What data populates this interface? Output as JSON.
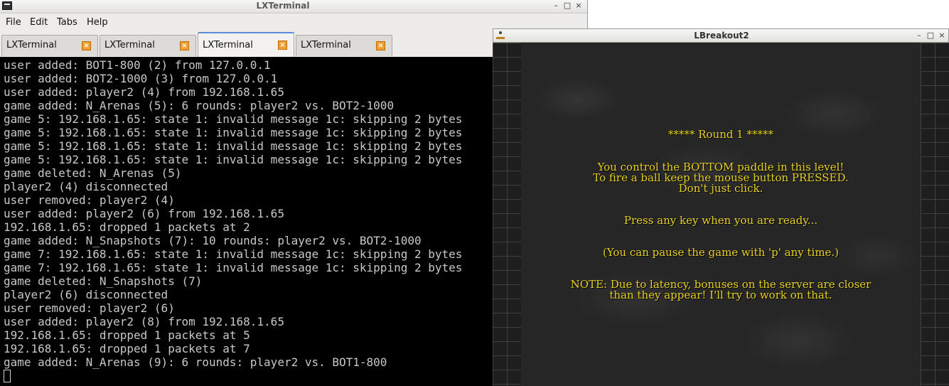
{
  "terminal": {
    "title": "LXTerminal",
    "controls": {
      "minimize": "–",
      "maximize": "□",
      "close": "×"
    },
    "menu": [
      "File",
      "Edit",
      "Tabs",
      "Help"
    ],
    "tabs": [
      {
        "label": "LXTerminal",
        "close": "×"
      },
      {
        "label": "LXTerminal",
        "close": "×"
      },
      {
        "label": "LXTerminal",
        "close": "×"
      },
      {
        "label": "LXTerminal",
        "close": "×"
      }
    ],
    "lines": [
      "user added: BOT1-800 (2) from 127.0.0.1",
      "user added: BOT2-1000 (3) from 127.0.0.1",
      "user added: player2 (4) from 192.168.1.65",
      "game added: N_Arenas (5): 6 rounds: player2 vs. BOT2-1000",
      "game 5: 192.168.1.65: state 1: invalid message 1c: skipping 2 bytes",
      "game 5: 192.168.1.65: state 1: invalid message 1c: skipping 2 bytes",
      "game 5: 192.168.1.65: state 1: invalid message 1c: skipping 2 bytes",
      "game 5: 192.168.1.65: state 1: invalid message 1c: skipping 2 bytes",
      "game deleted: N_Arenas (5)",
      "player2 (4) disconnected",
      "user removed: player2 (4)",
      "user added: player2 (6) from 192.168.1.65",
      "192.168.1.65: dropped 1 packets at 2",
      "game added: N_Snapshots (7): 10 rounds: player2 vs. BOT2-1000",
      "game 7: 192.168.1.65: state 1: invalid message 1c: skipping 2 bytes",
      "game 7: 192.168.1.65: state 1: invalid message 1c: skipping 2 bytes",
      "game deleted: N_Snapshots (7)",
      "player2 (6) disconnected",
      "user removed: player2 (6)",
      "user added: player2 (8) from 192.168.1.65",
      "192.168.1.65: dropped 1 packets at 5",
      "192.168.1.65: dropped 1 packets at 7",
      "game added: N_Arenas (9): 6 rounds: player2 vs. BOT1-800"
    ]
  },
  "lbreakout": {
    "title": "LBreakout2",
    "controls": {
      "minimize": "–",
      "maximize": "□",
      "close": "×"
    },
    "round": "***** Round 1 *****",
    "instructions": [
      "You control the BOTTOM paddle in this level!",
      "To fire a ball keep the mouse button PRESSED.",
      "Don't just click."
    ],
    "press_key": "Press any key when you are ready...",
    "pause_hint": "(You can pause the game with 'p' any time.)",
    "note": [
      "NOTE: Due to latency, bonuses on the server are closer",
      "than they appear! I'll try to work on that."
    ],
    "text_color": "#e8d022"
  }
}
